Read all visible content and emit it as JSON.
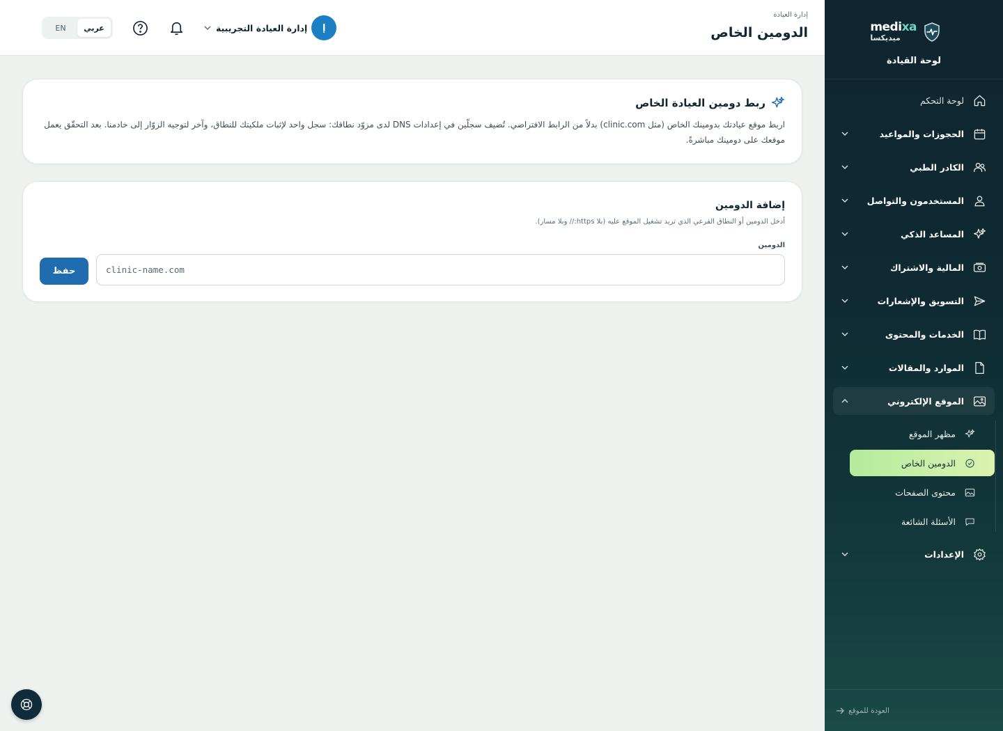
{
  "sidebar": {
    "brand_en_prefix": "medi",
    "brand_en_suffix": "xa",
    "brand_ar": "ميديكسا",
    "subtitle": "لوحة القيادة",
    "items": [
      {
        "label": "لوحة التحكم",
        "icon": "home-icon"
      },
      {
        "label": "الحجوزات والمواعيد",
        "icon": "calendar-icon"
      },
      {
        "label": "الكادر الطبي",
        "icon": "users-icon"
      },
      {
        "label": "المستخدمون والتواصل",
        "icon": "user-icon"
      },
      {
        "label": "المساعد الذكي",
        "icon": "sparkles-icon"
      },
      {
        "label": "المالية والاشتراك",
        "icon": "money-icon"
      },
      {
        "label": "التسويق والإشعارات",
        "icon": "send-icon"
      },
      {
        "label": "الخدمات والمحتوى",
        "icon": "book-icon"
      },
      {
        "label": "الموارد والمقالات",
        "icon": "file-icon"
      },
      {
        "label": "الموقع الإلكتروني",
        "icon": "image-icon"
      },
      {
        "label": "الإعدادات",
        "icon": "gear-icon"
      }
    ],
    "website_sub": [
      {
        "label": "مظهر الموقع",
        "icon": "sparkles-icon"
      },
      {
        "label": "الدومين الخاص",
        "icon": "check-circle-icon"
      },
      {
        "label": "محتوى الصفحات",
        "icon": "image-icon"
      },
      {
        "label": "الأسئلة الشائعة",
        "icon": "chat-icon"
      }
    ],
    "back_link": "العودة للموقع"
  },
  "header": {
    "breadcrumb": "إدارة العيادة",
    "title": "الدومين الخاص",
    "lang_ar": "عربي",
    "lang_en": "EN",
    "user_initial": "إ",
    "user_name": "إدارة العيادة التجريبية"
  },
  "info_card": {
    "title": "ربط دومين العيادة الخاص",
    "description": "اربط موقع عيادتك بدومينك الخاص (مثل clinic.com) بدلاً من الرابط الافتراضي. تُضيف سجلّين في إعدادات DNS لدى مزوّد نطاقك: سجل واحد لإثبات ملكيتك للنطاق، وآخر لتوجيه الزوّار إلى خادمنا. بعد التحقّق يعمل موقعك على دومينك مباشرةً."
  },
  "form_card": {
    "title": "إضافة الدومين",
    "help": "أدخل الدومين أو النطاق الفرعي الذي تريد تشغيل الموقع عليه (بلا https:// وبلا مسار).",
    "field_label": "الدومين",
    "placeholder": "clinic-name.com",
    "save_label": "حفظ"
  },
  "colors": {
    "primary": "#1f6db0",
    "active_sub": "#c6eea6",
    "sidebar_bg": "#0f2530"
  }
}
